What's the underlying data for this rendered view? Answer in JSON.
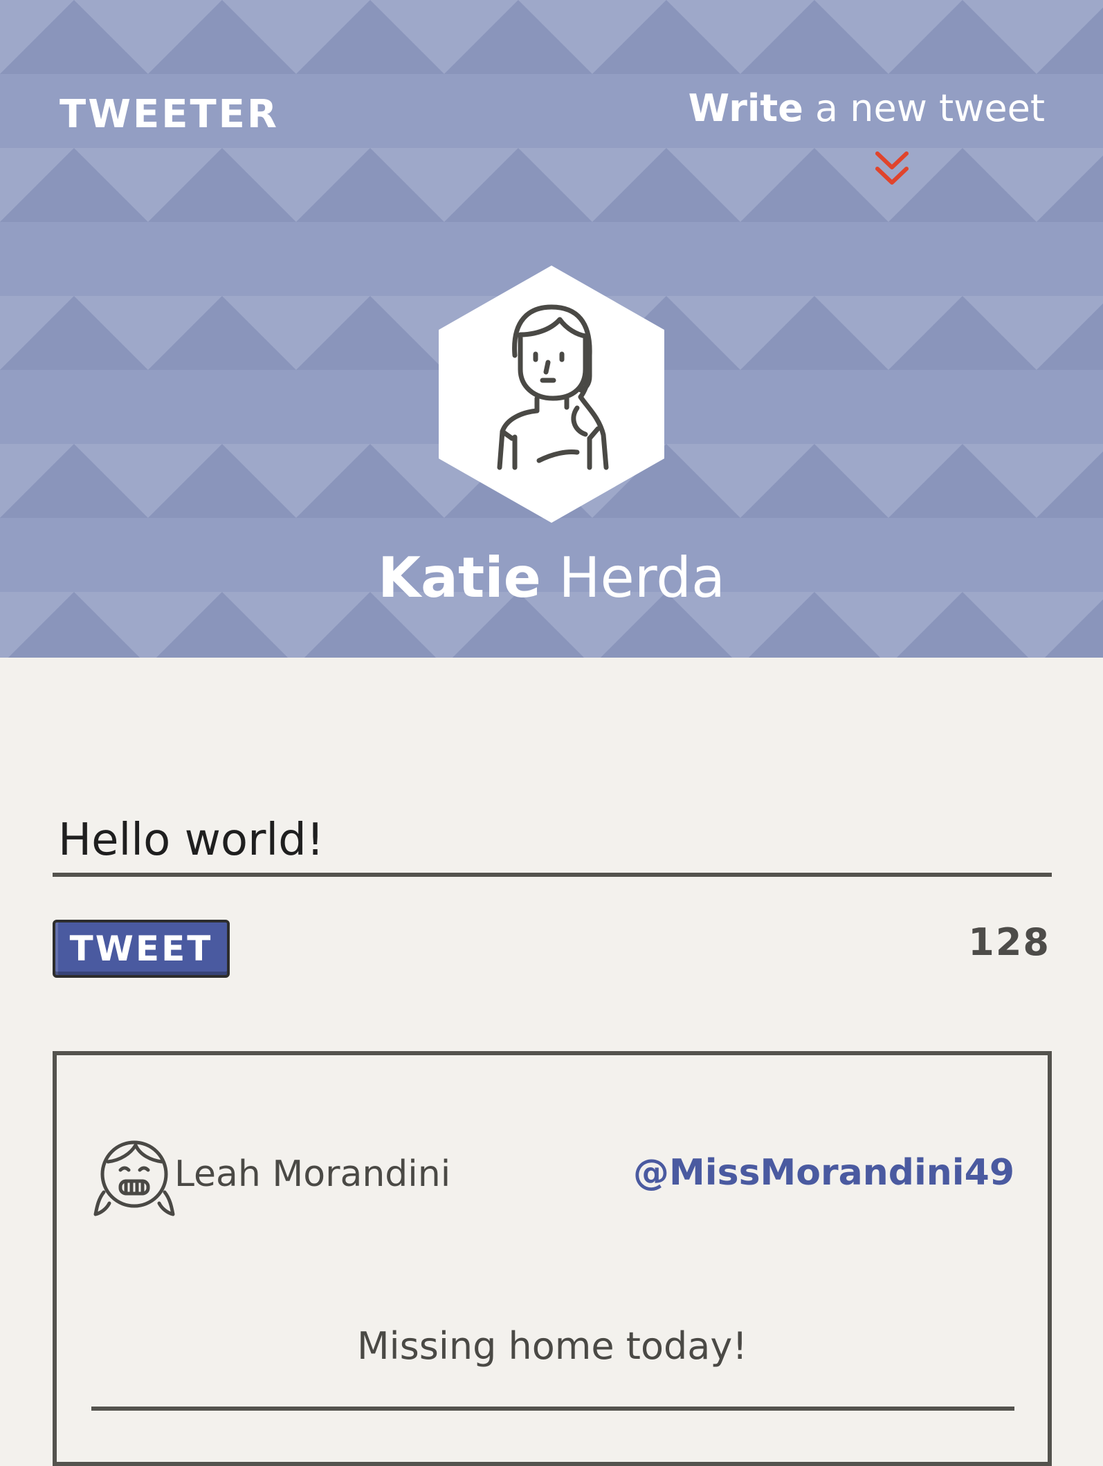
{
  "header": {
    "brand": "TWEETER",
    "write_link": {
      "bold": "Write",
      "rest": " a new tweet"
    },
    "chevron_icon": "double-chevron-down-icon",
    "accent_color": "#e0442c"
  },
  "profile": {
    "avatar_icon": "woman-avatar-icon",
    "first_name": "Katie",
    "last_name": " Herda"
  },
  "composer": {
    "input_value": "Hello world!",
    "tweet_button_label": "TWEET",
    "char_counter": "128"
  },
  "tweets": [
    {
      "avatar_icon": "girl-avatar-icon",
      "name": "Leah Morandini",
      "handle": "@MissMorandini49",
      "text": "Missing home today!"
    }
  ],
  "colors": {
    "header_bg": "#939ec3",
    "page_bg": "#f3f1ed",
    "primary": "#4a5aa0",
    "text_dark": "#54534e"
  }
}
